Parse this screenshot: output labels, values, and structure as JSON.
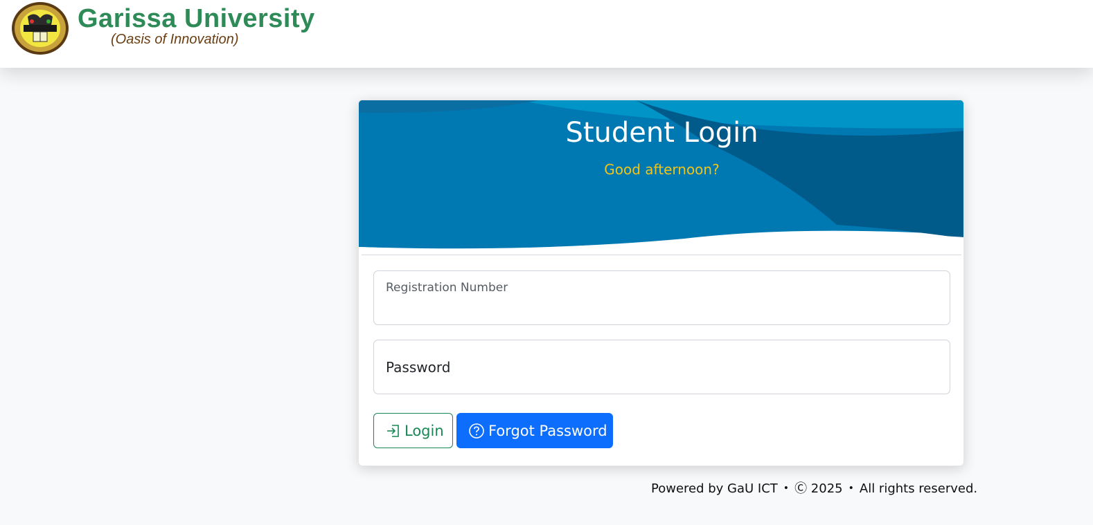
{
  "header": {
    "brand_name": "Garissa University",
    "tagline": "(Oasis of Innovation)",
    "logo_icon": "university-seal-icon"
  },
  "login_card": {
    "title": "Student Login",
    "greeting": "Good afternoon?",
    "registration_field": {
      "label": "Registration Number",
      "value": ""
    },
    "password_field": {
      "placeholder": "Password",
      "value": ""
    },
    "login_button": {
      "label": "Login",
      "icon": "login-arrow-icon"
    },
    "forgot_button": {
      "label": "Forgot Password",
      "icon": "question-circle-icon"
    }
  },
  "footer": {
    "powered_by": "Powered by GaU ICT",
    "copyright_year": "2025",
    "rights": "All rights reserved."
  },
  "colors": {
    "brand_green": "#2e8b57",
    "tagline_brown": "#6b3e12",
    "banner_blue": "#0078b0",
    "greeting_yellow": "#f0c419",
    "login_green": "#198754",
    "forgot_blue": "#0d6efd"
  }
}
